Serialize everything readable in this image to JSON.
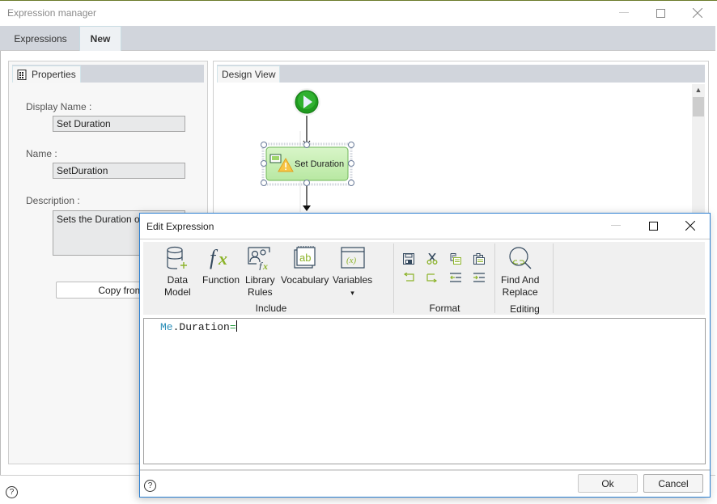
{
  "main_window": {
    "title": "Expression manager",
    "tabs": [
      {
        "label": "Expressions",
        "active": false
      },
      {
        "label": "New",
        "active": true
      }
    ]
  },
  "properties_panel": {
    "tab_label": "Properties",
    "display_name_label": "Display Name :",
    "display_name_value": "Set Duration",
    "name_label": "Name :",
    "name_value": "SetDuration",
    "description_label": "Description :",
    "description_value": "Sets the Duration of",
    "copy_from_button": "Copy from"
  },
  "design_view": {
    "tab_label": "Design View",
    "nodes": [
      {
        "type": "start",
        "icon": "play-icon"
      },
      {
        "type": "rule",
        "label": "Set Duration",
        "icon": "form-icon",
        "status": "warning",
        "selected": true
      }
    ]
  },
  "edit_expression_dialog": {
    "title": "Edit Expression",
    "ribbon": {
      "groups": [
        {
          "label": "Include",
          "buttons": [
            {
              "label_line1": "Data",
              "label_line2": "Model",
              "icon": "database-add-icon"
            },
            {
              "label_line1": "Function",
              "label_line2": "",
              "icon": "function-fx-icon"
            },
            {
              "label_line1": "Library",
              "label_line2": "Rules",
              "icon": "library-rules-icon"
            },
            {
              "label_line1": "Vocabulary",
              "label_line2": "",
              "icon": "vocabulary-icon"
            },
            {
              "label_line1": "Variables",
              "label_line2": "▾",
              "icon": "variables-icon"
            }
          ]
        },
        {
          "label": "Format",
          "buttons": [
            {
              "name": "save",
              "icon": "save-icon"
            },
            {
              "name": "cut",
              "icon": "cut-icon"
            },
            {
              "name": "copy",
              "icon": "copy-icon"
            },
            {
              "name": "paste",
              "icon": "paste-icon"
            },
            {
              "name": "undo",
              "icon": "undo-icon"
            },
            {
              "name": "redo",
              "icon": "redo-icon"
            },
            {
              "name": "outdent",
              "icon": "outdent-icon"
            },
            {
              "name": "indent",
              "icon": "indent-icon"
            }
          ]
        },
        {
          "label": "Editing",
          "buttons": [
            {
              "label_line1": "Find And",
              "label_line2": "Replace",
              "icon": "find-replace-icon"
            }
          ]
        }
      ]
    },
    "expression": {
      "object": "Me",
      "dot": ".",
      "property": "Duration",
      "operator": "="
    },
    "ok_button": "Ok",
    "cancel_button": "Cancel",
    "help": "?"
  },
  "colors": {
    "accent_green": "#8cb32a",
    "dialog_border": "#2b7fd1",
    "node_fill": "#c9efb8",
    "icon_dark": "#34495e"
  }
}
